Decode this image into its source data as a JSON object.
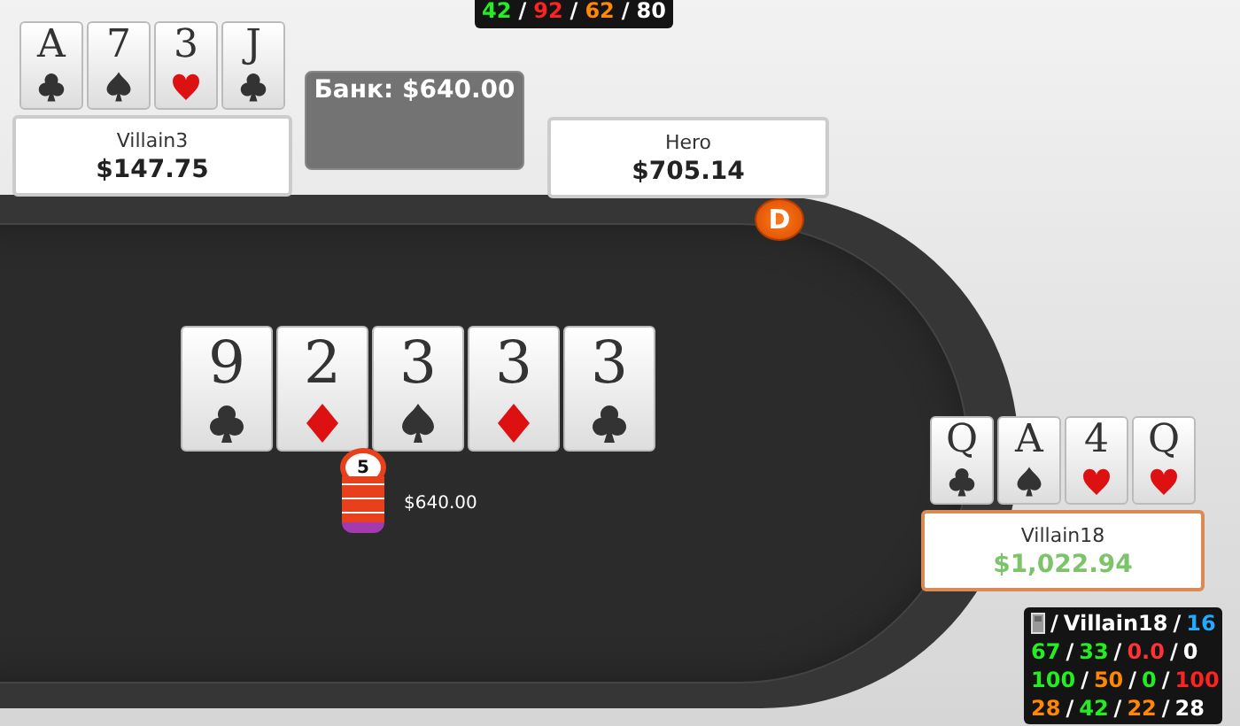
{
  "top_hud": {
    "lines": [
      [
        {
          "text": "42",
          "color": "#22ee22"
        },
        {
          "text": "/",
          "color": "#ffffff"
        },
        {
          "text": "92",
          "color": "#ff2222"
        },
        {
          "text": "/",
          "color": "#ffffff"
        },
        {
          "text": "62",
          "color": "#ff8800"
        },
        {
          "text": "/",
          "color": "#ffffff"
        },
        {
          "text": "80",
          "color": "#ffffff"
        }
      ]
    ]
  },
  "pot": {
    "label": "Банк: $640.00"
  },
  "seats": [
    {
      "name": "Villain3",
      "stack": "$147.75",
      "active": false,
      "dealer": false,
      "cards": [
        {
          "rank": "A",
          "kind": "clubs"
        },
        {
          "rank": "7",
          "kind": "spades"
        },
        {
          "rank": "3",
          "kind": "hearts"
        },
        {
          "rank": "J",
          "kind": "clubs"
        }
      ]
    },
    {
      "name": "Hero",
      "stack": "$705.14",
      "active": false,
      "dealer": true,
      "dealer_label": "D"
    },
    {
      "name": "Villain18",
      "stack": "$1,022.94",
      "active": true,
      "dealer": false,
      "cards": [
        {
          "rank": "Q",
          "kind": "clubs"
        },
        {
          "rank": "A",
          "kind": "spades"
        },
        {
          "rank": "4",
          "kind": "hearts"
        },
        {
          "rank": "Q",
          "kind": "hearts"
        }
      ]
    }
  ],
  "board": [
    {
      "rank": "9",
      "kind": "clubs"
    },
    {
      "rank": "2",
      "kind": "diamonds"
    },
    {
      "rank": "3",
      "kind": "spades"
    },
    {
      "rank": "3",
      "kind": "diamonds"
    },
    {
      "rank": "3",
      "kind": "clubs"
    }
  ],
  "bet": {
    "chip_label": "5",
    "amount": "$640.00"
  },
  "player_hud": {
    "lines": [
      [
        {
          "text": "/",
          "color": "#ffffff"
        },
        {
          "text": "Villain18",
          "color": "#ffffff"
        },
        {
          "text": "/",
          "color": "#ffffff"
        },
        {
          "text": "16",
          "color": "#22aaff"
        }
      ],
      [
        {
          "text": "67",
          "color": "#22ee22"
        },
        {
          "text": "/",
          "color": "#ffffff"
        },
        {
          "text": "33",
          "color": "#22ee22"
        },
        {
          "text": "/",
          "color": "#ffffff"
        },
        {
          "text": "0.0",
          "color": "#ff3333"
        },
        {
          "text": "/",
          "color": "#ffffff"
        },
        {
          "text": "0",
          "color": "#ffffff"
        }
      ],
      [
        {
          "text": "100",
          "color": "#22ee22"
        },
        {
          "text": "/",
          "color": "#ffffff"
        },
        {
          "text": "50",
          "color": "#ff8800"
        },
        {
          "text": "/",
          "color": "#ffffff"
        },
        {
          "text": "0",
          "color": "#22ee22"
        },
        {
          "text": "/",
          "color": "#ffffff"
        },
        {
          "text": "100",
          "color": "#ff2222"
        }
      ],
      [
        {
          "text": "28",
          "color": "#ff8800"
        },
        {
          "text": "/",
          "color": "#ffffff"
        },
        {
          "text": "42",
          "color": "#22ee22"
        },
        {
          "text": "/",
          "color": "#ffffff"
        },
        {
          "text": "22",
          "color": "#ff8800"
        },
        {
          "text": "/",
          "color": "#ffffff"
        },
        {
          "text": "28",
          "color": "#ffffff"
        }
      ]
    ]
  }
}
